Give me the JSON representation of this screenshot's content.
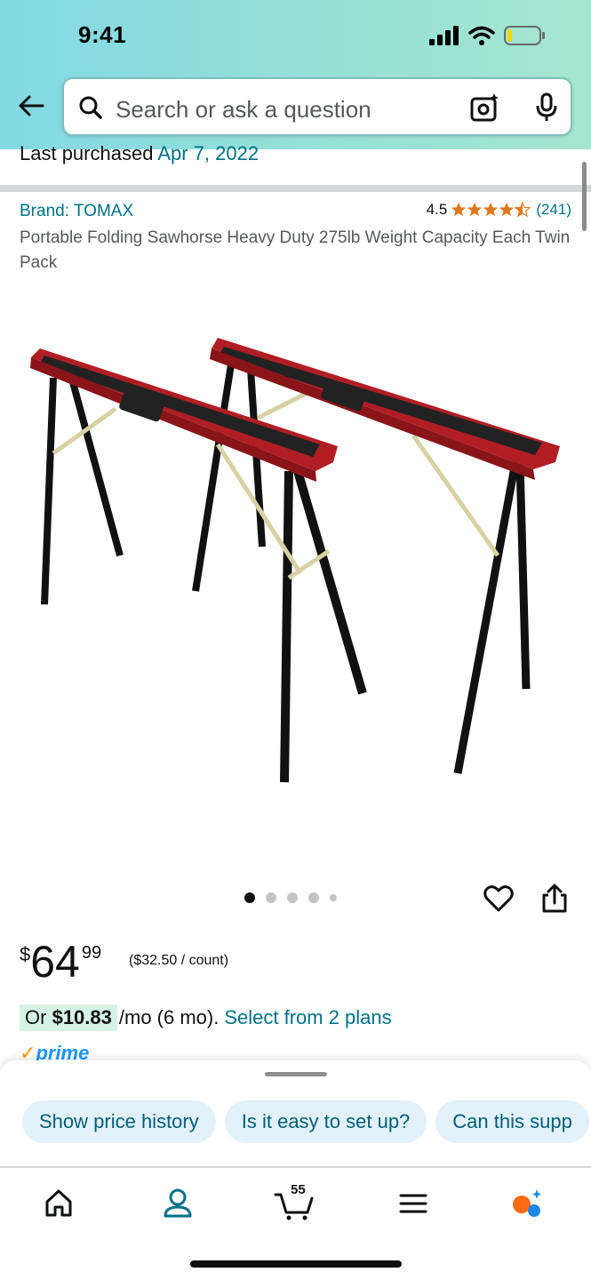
{
  "status": {
    "time": "9:41"
  },
  "search": {
    "placeholder": "Search or ask a question"
  },
  "last_purchased": {
    "label": "Last purchased",
    "date": "Apr 7, 2022"
  },
  "product": {
    "brand": "Brand: TOMAX",
    "rating": "4.5",
    "rating_count": "(241)",
    "stars": 4.5,
    "title": "Portable Folding Sawhorse Heavy Duty 275lb Weight Capacity Each Twin Pack",
    "image_count": 5,
    "active_image": 1
  },
  "price": {
    "symbol": "$",
    "whole": "64",
    "fraction": "99",
    "unit_price": "($32.50 / count)"
  },
  "installment": {
    "prefix": "Or",
    "amount": "$10.83",
    "terms": "/mo (6 mo).",
    "link": "Select from 2 plans"
  },
  "prime": {
    "check": "✓",
    "label": "prime"
  },
  "suggestions": [
    "Show price history",
    "Is it easy to set up?",
    "Can this supp"
  ],
  "cart": {
    "count": "55"
  },
  "colors": {
    "link": "#007185",
    "prime": "#1a98ff",
    "star": "#de7921",
    "accent": "#ff9900"
  },
  "nav_icons": [
    "home-icon",
    "account-icon",
    "cart-icon",
    "menu-icon",
    "rufus-icon"
  ]
}
